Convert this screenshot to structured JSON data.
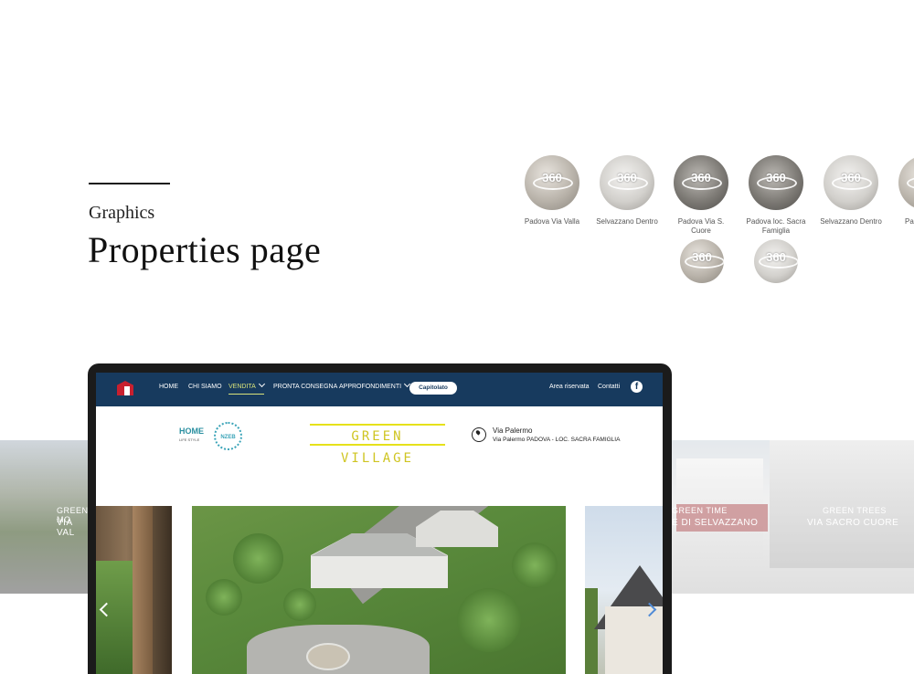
{
  "section": {
    "label": "Graphics",
    "title": "Properties page"
  },
  "tours": [
    {
      "label": "Padova Via Valla",
      "badge": "360"
    },
    {
      "label": "Selvazzano Dentro",
      "badge": "360"
    },
    {
      "label": "Padova Via S. Cuore",
      "badge": "360"
    },
    {
      "label": "Padova loc. Sacra Famiglia",
      "badge": "360"
    },
    {
      "label": "Selvazzano Dentro",
      "badge": "360"
    },
    {
      "label": "Pa",
      "badge": "360"
    },
    {
      "label": "",
      "badge": "360"
    },
    {
      "label": "",
      "badge": "360"
    }
  ],
  "nav": {
    "items": [
      "HOME",
      "CHI SIAMO",
      "VENDITA",
      "PRONTA CONSEGNA",
      "APPROFONDIMENTI"
    ],
    "cta": "Capitolato",
    "right": [
      "Area riservata",
      "Contatti"
    ],
    "social": "f"
  },
  "hero": {
    "home_logo": "HOME",
    "home_logo_sub": "LIFE STYLE",
    "nzeb": "NZEB",
    "project_name": "GREEN VILLAGE",
    "address_title": "Via Palermo",
    "address_sub": "Via Palermo PADOVA - LOC. SACRA FAMIGLIA"
  },
  "background_strips": {
    "left": {
      "small": "GREEN MO",
      "big": "VIA VAL"
    },
    "right_1": {
      "small": "GREEN TIME",
      "big": "E DI SELVAZZANO"
    },
    "right_2": {
      "small": "GREEN TREES",
      "big": "VIA SACRO CUORE"
    }
  }
}
